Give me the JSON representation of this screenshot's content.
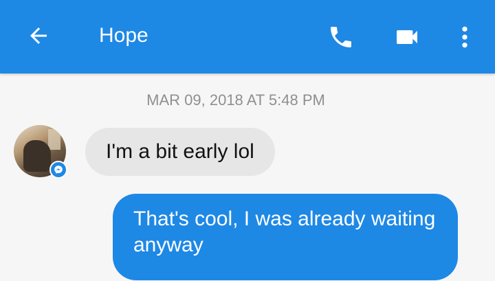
{
  "header": {
    "title": "Hope",
    "icons": {
      "back": "arrow-back-icon",
      "call": "phone-icon",
      "video": "video-camera-icon",
      "more": "more-vertical-icon"
    }
  },
  "conversation": {
    "timestamp": "MAR 09, 2018 AT 5:48 PM",
    "messages": [
      {
        "from": "Hope",
        "direction": "incoming",
        "text": "I'm a bit early lol"
      },
      {
        "from": "me",
        "direction": "outgoing",
        "text": "That's cool, I was already waiting anyway"
      }
    ]
  },
  "colors": {
    "accent": "#1e88e5",
    "incoming_bubble": "#e6e6e6",
    "background": "#f6f6f6",
    "timestamp_text": "#8f8f8f"
  }
}
